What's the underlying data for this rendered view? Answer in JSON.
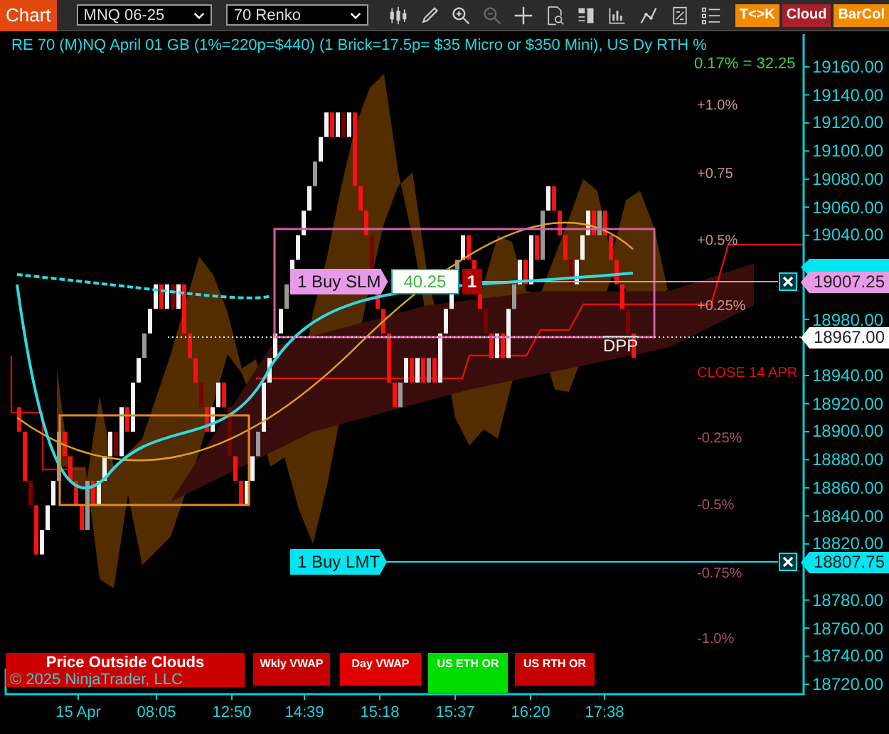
{
  "toolbar": {
    "title": "Chart",
    "instrument": {
      "value": "MNQ 06-25"
    },
    "bar_type": {
      "value": "70 Renko"
    },
    "buttons": [
      {
        "label": "T<>K",
        "color": "#f28a00"
      },
      {
        "label": "Cloud",
        "color": "#a8202a"
      },
      {
        "label": "BarCol",
        "color": "#f28a00"
      }
    ]
  },
  "chart": {
    "caption": "RE 70 (M)NQ April 01 GB (1%=220p=$440) (1 Brick=17.5p= $35 Micro or $350 Mini), US Dy RTH %",
    "overlay_value": "0.17% = 32.25",
    "percent_labels": [
      {
        "text": "+1.0%",
        "kind": "positive"
      },
      {
        "text": "+0.75",
        "kind": "positive"
      },
      {
        "text": "+0.5%",
        "kind": "positive"
      },
      {
        "text": "+0.25%",
        "kind": "positive"
      },
      {
        "text": "CLOSE 14 APR",
        "kind": "close"
      },
      {
        "text": "-0.25%",
        "kind": "negative"
      },
      {
        "text": "-0.5%",
        "kind": "negative"
      },
      {
        "text": "-0.75%",
        "kind": "negative"
      },
      {
        "text": "-1.0%",
        "kind": "negative"
      }
    ],
    "orders": [
      {
        "label": "1 Buy SLM",
        "kind": "stop",
        "pnl": "40.25",
        "quantity": "1"
      },
      {
        "label": "1 Buy LMT",
        "kind": "limit"
      }
    ],
    "marker_label": "DPP",
    "price_axis": [
      "19160.00",
      "19140.00",
      "19120.00",
      "19100.00",
      "19080.00",
      "19060.00",
      "19040.00",
      "18980.00",
      "18940.00",
      "18920.00",
      "18900.00",
      "18880.00",
      "18860.00",
      "18840.00",
      "18820.00",
      "18780.00",
      "18760.00",
      "18740.00",
      "18720.00"
    ],
    "price_tags": [
      {
        "price": "19007.25",
        "kind": "order"
      },
      {
        "price": "18967.00",
        "kind": "last"
      },
      {
        "price": "18807.75",
        "kind": "limit"
      }
    ],
    "indicators": [
      {
        "label": "Price Outside Clouds",
        "color": "#cc0000"
      },
      {
        "label": "Wkly VWAP",
        "color": "#c40000"
      },
      {
        "label": "Day VWAP",
        "color": "#e00000"
      },
      {
        "label": "US ETH OR",
        "color": "#00dd00"
      },
      {
        "label": "US RTH OR",
        "color": "#c40000"
      }
    ],
    "copyright": "© 2025 NinjaTrader, LLC",
    "time_axis": [
      "15 Apr",
      "08:05",
      "12:50",
      "14:39",
      "15:18",
      "15:37",
      "16:20",
      "17:38"
    ]
  }
}
